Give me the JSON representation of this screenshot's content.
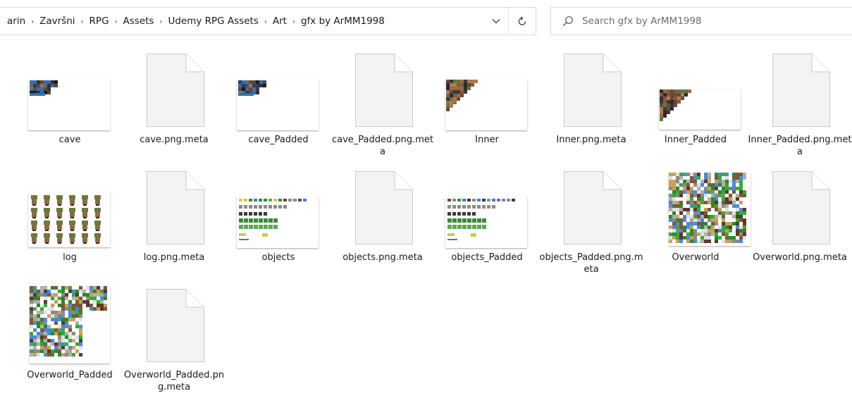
{
  "breadcrumb": [
    "arin",
    "Završni",
    "RPG",
    "Assets",
    "Udemy RPG Assets",
    "Art",
    "gfx by ArMM1998"
  ],
  "search": {
    "placeholder": "Search gfx by ArMM1998",
    "value": ""
  },
  "icons": {
    "dropdown": "chevron-down-icon",
    "refresh": "refresh-icon",
    "search": "search-icon",
    "generic_file": "document-icon"
  },
  "colors": {
    "border": "#d9d9d9",
    "doc_fill": "#f2f2f2",
    "doc_stroke": "#c8c8c8"
  },
  "files": [
    {
      "name": "cave",
      "kind": "image"
    },
    {
      "name": "cave.png.meta",
      "kind": "file"
    },
    {
      "name": "cave_Padded",
      "kind": "image"
    },
    {
      "name": "cave_Padded.png.meta",
      "kind": "file"
    },
    {
      "name": "Inner",
      "kind": "image"
    },
    {
      "name": "Inner.png.meta",
      "kind": "file"
    },
    {
      "name": "Inner_Padded",
      "kind": "image"
    },
    {
      "name": "Inner_Padded.png.meta",
      "kind": "file"
    },
    {
      "name": "log",
      "kind": "image"
    },
    {
      "name": "log.png.meta",
      "kind": "file"
    },
    {
      "name": "objects",
      "kind": "image"
    },
    {
      "name": "objects.png.meta",
      "kind": "file"
    },
    {
      "name": "objects_Padded",
      "kind": "image"
    },
    {
      "name": "objects_Padded.png.meta",
      "kind": "file"
    },
    {
      "name": "Overworld",
      "kind": "image"
    },
    {
      "name": "Overworld.png.meta",
      "kind": "file"
    },
    {
      "name": "Overworld_Padded",
      "kind": "image"
    },
    {
      "name": "Overworld_Padded.png.meta",
      "kind": "file"
    }
  ]
}
